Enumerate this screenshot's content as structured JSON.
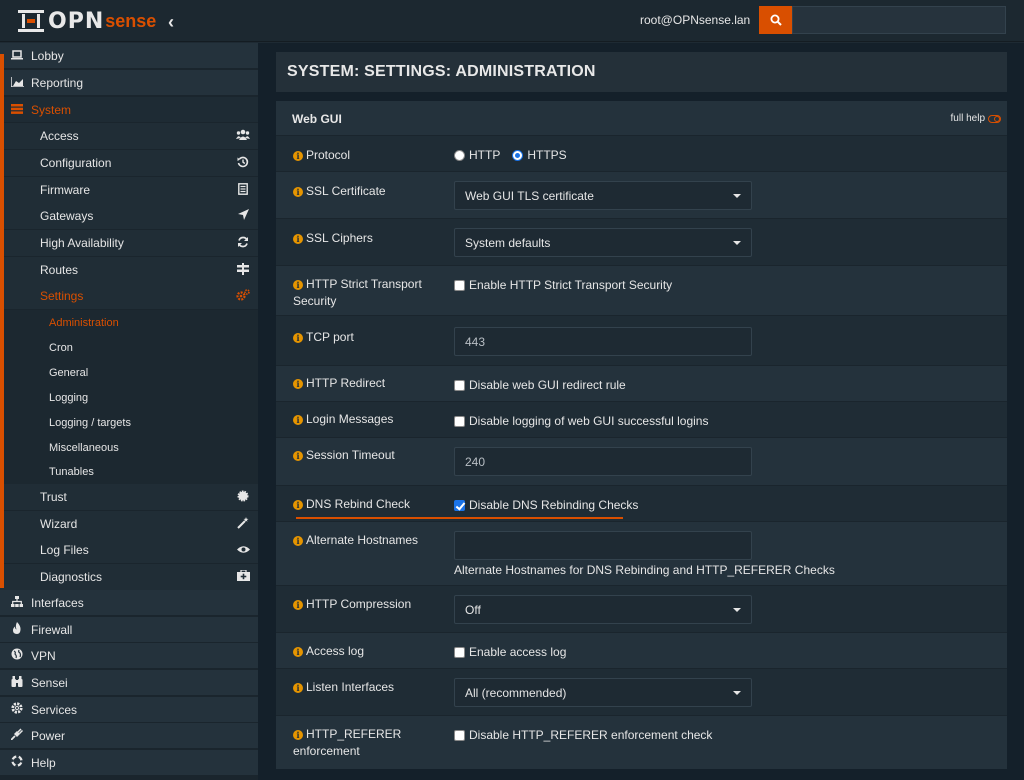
{
  "header": {
    "logo_opn": "OPN",
    "logo_sense": "sense",
    "user": "root@OPNsense.lan",
    "search_placeholder": ""
  },
  "sidebar": {
    "main_items": [
      {
        "label": "Lobby",
        "icon": "laptop-icon"
      },
      {
        "label": "Reporting",
        "icon": "area-chart-icon"
      },
      {
        "label": "System",
        "icon": "server-icon"
      }
    ],
    "system_sub": [
      {
        "label": "Access",
        "icon": "users-icon"
      },
      {
        "label": "Configuration",
        "icon": "history-icon"
      },
      {
        "label": "Firmware",
        "icon": "list-document-icon"
      },
      {
        "label": "Gateways",
        "icon": "location-arrow-icon"
      },
      {
        "label": "High Availability",
        "icon": "refresh-icon"
      },
      {
        "label": "Routes",
        "icon": "signpost-icon"
      },
      {
        "label": "Settings",
        "icon": "cogs-icon"
      }
    ],
    "settings_sub": [
      "Administration",
      "Cron",
      "General",
      "Logging",
      "Logging / targets",
      "Miscellaneous",
      "Tunables"
    ],
    "system_sub2": [
      {
        "label": "Trust",
        "icon": "certificate-icon"
      },
      {
        "label": "Wizard",
        "icon": "magic-icon"
      },
      {
        "label": "Log Files",
        "icon": "eye-icon"
      },
      {
        "label": "Diagnostics",
        "icon": "medkit-icon"
      }
    ],
    "bottom_items": [
      {
        "label": "Interfaces",
        "icon": "sitemap-icon"
      },
      {
        "label": "Firewall",
        "icon": "fire-icon"
      },
      {
        "label": "VPN",
        "icon": "globe-icon"
      },
      {
        "label": "Sensei",
        "icon": "binoculars-icon"
      },
      {
        "label": "Services",
        "icon": "gear-icon"
      },
      {
        "label": "Power",
        "icon": "plug-icon"
      },
      {
        "label": "Help",
        "icon": "life-ring-icon"
      }
    ]
  },
  "page": {
    "title": "SYSTEM: SETTINGS: ADMINISTRATION",
    "panel_title": "Web GUI",
    "full_help": "full help"
  },
  "form": {
    "protocol": {
      "label": "Protocol",
      "options": [
        "HTTP",
        "HTTPS"
      ],
      "selected": "HTTPS"
    },
    "ssl_certificate": {
      "label": "SSL Certificate",
      "value": "Web GUI TLS certificate"
    },
    "ssl_ciphers": {
      "label": "SSL Ciphers",
      "value": "System defaults"
    },
    "hsts": {
      "label": "HTTP Strict Transport Security",
      "checkbox": "Enable HTTP Strict Transport Security",
      "checked": false
    },
    "tcp_port": {
      "label": "TCP port",
      "placeholder": "443"
    },
    "http_redirect": {
      "label": "HTTP Redirect",
      "checkbox": "Disable web GUI redirect rule",
      "checked": false
    },
    "login_messages": {
      "label": "Login Messages",
      "checkbox": "Disable logging of web GUI successful logins",
      "checked": false
    },
    "session_timeout": {
      "label": "Session Timeout",
      "placeholder": "240"
    },
    "dns_rebind": {
      "label": "DNS Rebind Check",
      "checkbox": "Disable DNS Rebinding Checks",
      "checked": true
    },
    "alt_hostnames": {
      "label": "Alternate Hostnames",
      "value": "",
      "hint": "Alternate Hostnames for DNS Rebinding and HTTP_REFERER Checks"
    },
    "http_compression": {
      "label": "HTTP Compression",
      "value": "Off"
    },
    "access_log": {
      "label": "Access log",
      "checkbox": "Enable access log",
      "checked": false
    },
    "listen_interfaces": {
      "label": "Listen Interfaces",
      "value": "All (recommended)"
    },
    "http_referer": {
      "label": "HTTP_REFERER enforcement",
      "checkbox": "Disable HTTP_REFERER enforcement check",
      "checked": false
    }
  },
  "colors": {
    "accent": "#d94f00",
    "info": "#e69500",
    "bg": "#1e2a33"
  }
}
